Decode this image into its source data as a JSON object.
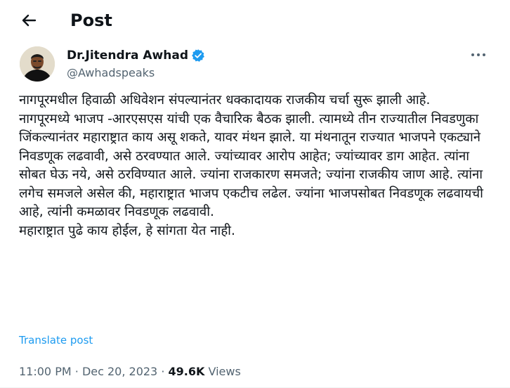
{
  "header": {
    "title": "Post",
    "back_icon": "arrow-left-icon"
  },
  "author": {
    "name": "Dr.Jitendra Awhad",
    "handle": "@Awhadspeaks",
    "verified_icon": "verified-badge-icon",
    "verified_color": "#1d9bf0",
    "more_icon": "more-horizontal-icon"
  },
  "post": {
    "paragraphs": [
      "नागपूरमधील हिवाळी अधिवेशन संपल्यानंतर धक्कादायक राजकीय चर्चा सुरू झाली आहे.",
      "नागपूरमध्ये भाजप -आरएसएस यांची एक वैचारिक बैठक झाली. त्यामध्ये तीन राज्यातील निवडणुका जिंकल्यानंतर महाराष्ट्रात काय असू शकते, यावर मंथन झाले. या मंथनातून राज्यात भाजपने एकट्याने निवडणूक लढवावी, असे ठरवण्यात आले. ज्यांच्यावर आरोप आहेत; ज्यांच्यावर डाग आहेत. त्यांना सोबत घेऊ नये, असे ठरविण्यात आले.  ज्यांना राजकारण समजते; ज्यांना राजकीय जाण आहे. त्यांना लगेच समजले असेल की, महाराष्ट्रात भाजप एकटीच लढेल. ज्यांना भाजपसोबत निवडणूक लढवायची आहे, त्यांनी कमळावर निवडणूक लढवावी.",
      "महाराष्ट्रात पुढे काय होईल,  हे सांगता येत नाही."
    ],
    "translate_label": "Translate post",
    "time": "11:00 PM",
    "separator": "·",
    "date": "Dec 20, 2023",
    "views_count": "49.6K",
    "views_label": "Views"
  },
  "colors": {
    "link": "#1d9bf0",
    "secondary_text": "#536471",
    "primary_text": "#0f1419"
  }
}
